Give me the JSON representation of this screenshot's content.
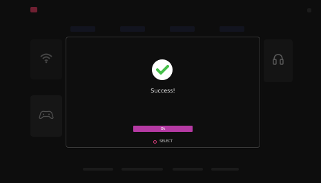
{
  "topbar": {
    "left_label": "",
    "accent_icon": "gamepad-icon",
    "right_badge": ""
  },
  "background": {
    "tiles": [
      {
        "name": "wifi-tile",
        "icon": "wifi-icon"
      },
      {
        "name": "gamepad-tile",
        "icon": "gamepad-icon"
      },
      {
        "name": "headset-tile",
        "icon": "headset-icon"
      }
    ]
  },
  "dialog": {
    "title": "Success!",
    "ok_label": "Ok",
    "select_hint": "SELECT",
    "icon": "success-check-icon",
    "colors": {
      "accent": "#b53aa3",
      "success": "#46c04a"
    }
  }
}
